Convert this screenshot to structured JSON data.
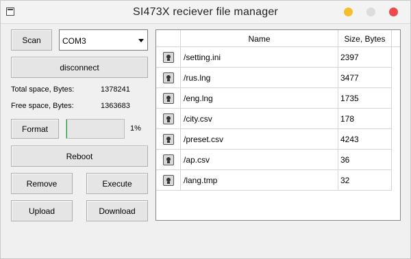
{
  "window": {
    "title": "SI473X reciever file manager"
  },
  "controls": {
    "scan_label": "Scan",
    "port_value": "COM3",
    "disconnect_label": "disconnect",
    "total_space_label": "Total space, Bytes:",
    "total_space_value": "1378241",
    "free_space_label": "Free space, Bytes:",
    "free_space_value": "1363683",
    "format_label": "Format",
    "progress_percent": 1,
    "progress_text": "1%",
    "reboot_label": "Reboot",
    "remove_label": "Remove",
    "execute_label": "Execute",
    "upload_label": "Upload",
    "download_label": "Download"
  },
  "table": {
    "headers": {
      "name": "Name",
      "size": "Size, Bytes"
    },
    "rows": [
      {
        "icon": "file-icon",
        "name": "/setting.ini",
        "size": "2397"
      },
      {
        "icon": "file-icon",
        "name": "/rus.lng",
        "size": "3477"
      },
      {
        "icon": "file-icon",
        "name": "/eng.lng",
        "size": "1735"
      },
      {
        "icon": "file-icon",
        "name": "/city.csv",
        "size": "178"
      },
      {
        "icon": "file-icon",
        "name": "/preset.csv",
        "size": "4243"
      },
      {
        "icon": "file-icon",
        "name": "/ap.csv",
        "size": "36"
      },
      {
        "icon": "file-icon",
        "name": "/lang.tmp",
        "size": "32"
      }
    ]
  }
}
